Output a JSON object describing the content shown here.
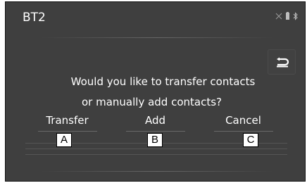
{
  "screen": {
    "title": "BT2",
    "status_icons": [
      "bluetooth-off-icon",
      "phone-battery-icon",
      "bluetooth-icon"
    ]
  },
  "dialog": {
    "message_line1": "Would you like to transfer contacts",
    "message_line2": "or manually add contacts?"
  },
  "buttons": [
    {
      "label": "Transfer",
      "callout": "A"
    },
    {
      "label": "Add",
      "callout": "B"
    },
    {
      "label": "Cancel",
      "callout": "C"
    }
  ],
  "return_icon": "return-arrow-icon"
}
